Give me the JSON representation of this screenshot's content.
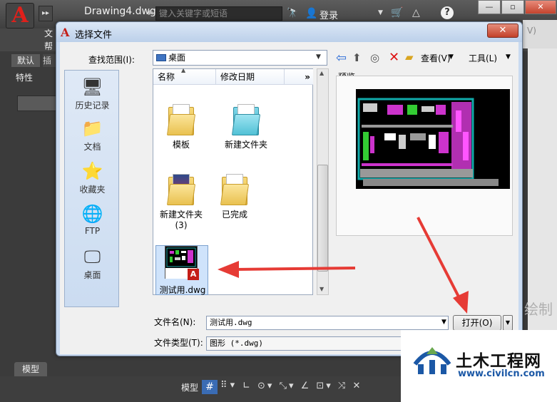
{
  "app": {
    "logo_letter": "A",
    "doc_title": "Drawing4.dwg",
    "search_placeholder": "键入关键字或短语",
    "login": "登录",
    "help": "?",
    "menu_partial_1": "文",
    "menu_partial_2": "帮",
    "ribbon_tab_default": "默认",
    "ribbon_tab_insert": "插",
    "properties": "特性",
    "layout_tab_model": "模型",
    "status_model": "模型",
    "right_watermark_partial": "绘制",
    "right_dialog_partial": "V)"
  },
  "dialog": {
    "title": "选择文件",
    "close": "✕",
    "lookin_label": "查找范围(I):",
    "lookin_value": "桌面",
    "view_label": "查看(V)",
    "tools_label": "工具(L)",
    "places": [
      {
        "label": "历史记录",
        "icon": "history-icon"
      },
      {
        "label": "文档",
        "icon": "documents-icon"
      },
      {
        "label": "收藏夹",
        "icon": "favorites-icon"
      },
      {
        "label": "FTP",
        "icon": "ftp-icon"
      },
      {
        "label": "桌面",
        "icon": "desktop-icon"
      }
    ],
    "columns": {
      "name": "名称",
      "date": "修改日期",
      "more": "»"
    },
    "items": [
      {
        "name": "模板",
        "type": "folder"
      },
      {
        "name": "新建文件夹",
        "type": "folder"
      },
      {
        "name": "新建文件夹 (3)",
        "type": "folder"
      },
      {
        "name": "已完成",
        "type": "folder"
      },
      {
        "name": "测试用.dwg",
        "type": "dwg",
        "selected": true
      }
    ],
    "preview_label": "预览",
    "filename_label": "文件名(N):",
    "filename_value": "测试用.dwg",
    "filetype_label": "文件类型(T):",
    "filetype_value": "图形 (*.dwg)",
    "open_button": "打开(O)"
  },
  "watermark": {
    "cn": "土木工程网",
    "url": "www.civilcn.com"
  },
  "colors": {
    "accent_red": "#e63b35",
    "autocad_red": "#c41d17",
    "selection": "#cfe3fb"
  }
}
